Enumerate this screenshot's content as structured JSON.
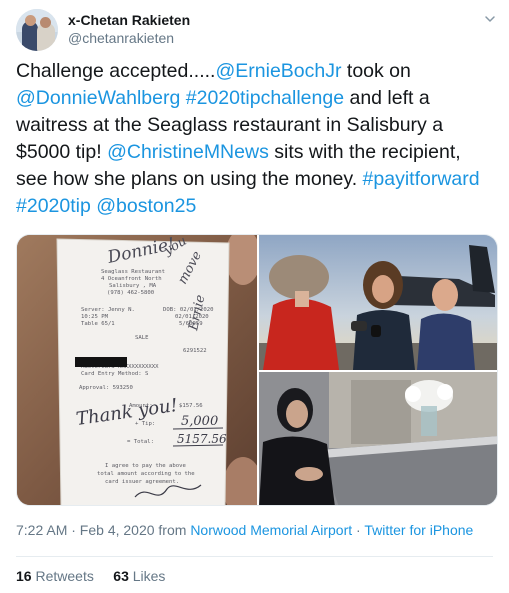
{
  "author": {
    "name": "x-Chetan Rakieten",
    "handle": "@chetanrakieten"
  },
  "tweet": {
    "segments": [
      {
        "text": "Challenge accepted.....",
        "link": false
      },
      {
        "text": "@ErnieBochJr",
        "link": true
      },
      {
        "text": " took on ",
        "link": false
      },
      {
        "text": "@DonnieWahlberg",
        "link": true
      },
      {
        "text": " ",
        "link": false
      },
      {
        "text": "#2020tipchallenge",
        "link": true
      },
      {
        "text": " and left a waitress at the Seaglass restaurant in Salisbury a $5000 tip! ",
        "link": false
      },
      {
        "text": "@ChristineMNews",
        "link": true
      },
      {
        "text": " sits with the recipient, see how she plans on using the money. ",
        "link": false
      },
      {
        "text": "#payitforward",
        "link": true
      },
      {
        "text": " ",
        "link": false
      },
      {
        "text": "#2020tip",
        "link": true
      },
      {
        "text": " ",
        "link": false
      },
      {
        "text": "@boston25",
        "link": true
      }
    ]
  },
  "receipt": {
    "handwriting_top": [
      "Donnie!",
      "you",
      "move",
      "Ernie"
    ],
    "restaurant_lines": [
      "Seaglass Restaurant",
      "4 Oceanfront North",
      "Salisbury , MA",
      "(978) 462-5800"
    ],
    "server": "Server: Jenny N.",
    "time": "10:25 PM",
    "table": "Table 65/1",
    "dates": [
      "DOB: 02/01/2020",
      "02/01/2020",
      "5/60059"
    ],
    "sale": "SALE",
    "number": "6291522",
    "card_line_a": "MasterCard  XXXXXXXXXXXX",
    "card_line_b": "Card Entry Method: S",
    "approval": "Approval: 593250",
    "amount_label": "Amount:",
    "amount": "$157.56",
    "tip_label": "+ Tip:",
    "tip": "5,000",
    "total_label": "= Total:",
    "total": "5157.56",
    "thanks": "Thank you!",
    "agree": [
      "I agree to pay the above",
      "total amount according to the",
      "card issuer agreement."
    ]
  },
  "timestamp": "7:22 AM · Feb 4, 2020 from ",
  "location": "Norwood  Memorial Airport",
  "separator": " · ",
  "source": "Twitter for iPhone",
  "stats": {
    "retweets": "16",
    "retweets_label": "Retweets",
    "likes": "63",
    "likes_label": "Likes"
  },
  "colors": {
    "link": "#1b95e0",
    "text": "#14171a",
    "secondary": "#657786"
  },
  "icons": {
    "caret": "chevron-down-icon"
  }
}
